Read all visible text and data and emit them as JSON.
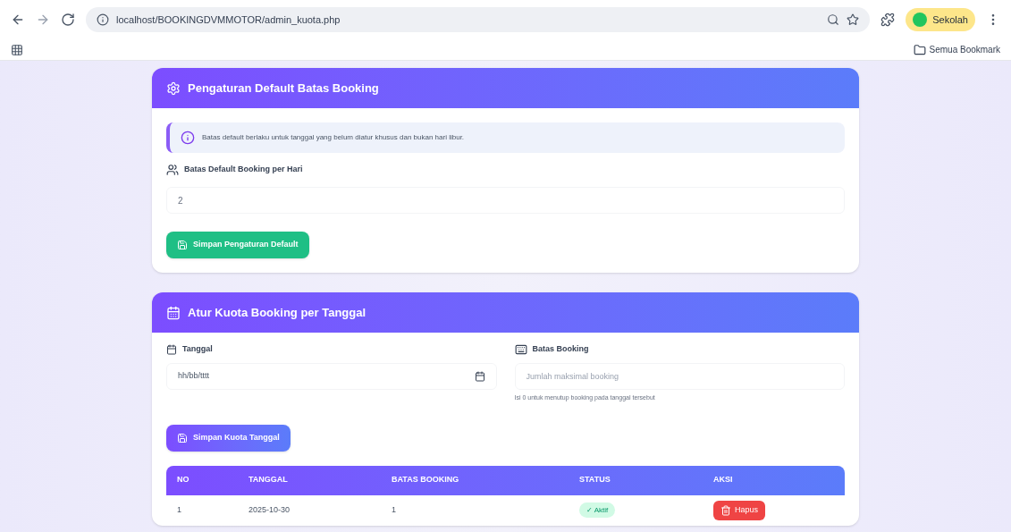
{
  "browser": {
    "url": "localhost/BOOKINGDVMMOTOR/admin_kuota.php",
    "profile": "Sekolah",
    "bookmarks_folder": "Semua Bookmark"
  },
  "default_card": {
    "title": "Pengaturan Default Batas Booking",
    "alert": "Batas default berlaku untuk tanggal yang belum diatur khusus dan bukan hari libur.",
    "label": "Batas Default Booking per Hari",
    "value": "2",
    "button": "Simpan Pengaturan Default"
  },
  "quota_card": {
    "title": "Atur Kuota Booking per Tanggal",
    "date_label": "Tanggal",
    "date_placeholder": "hh/bb/tttt",
    "limit_label": "Batas Booking",
    "limit_placeholder": "Jumlah maksimal booking",
    "limit_hint": "Isi 0 untuk menutup booking pada tanggal tersebut",
    "button": "Simpan Kuota Tanggal",
    "table": {
      "columns": [
        "NO",
        "TANGGAL",
        "BATAS BOOKING",
        "STATUS",
        "AKSI"
      ],
      "rows": [
        {
          "no": "1",
          "date": "2025-10-30",
          "limit": "1",
          "status": "✓ Aktif",
          "kind": "active",
          "action": "Hapus"
        }
      ]
    }
  }
}
